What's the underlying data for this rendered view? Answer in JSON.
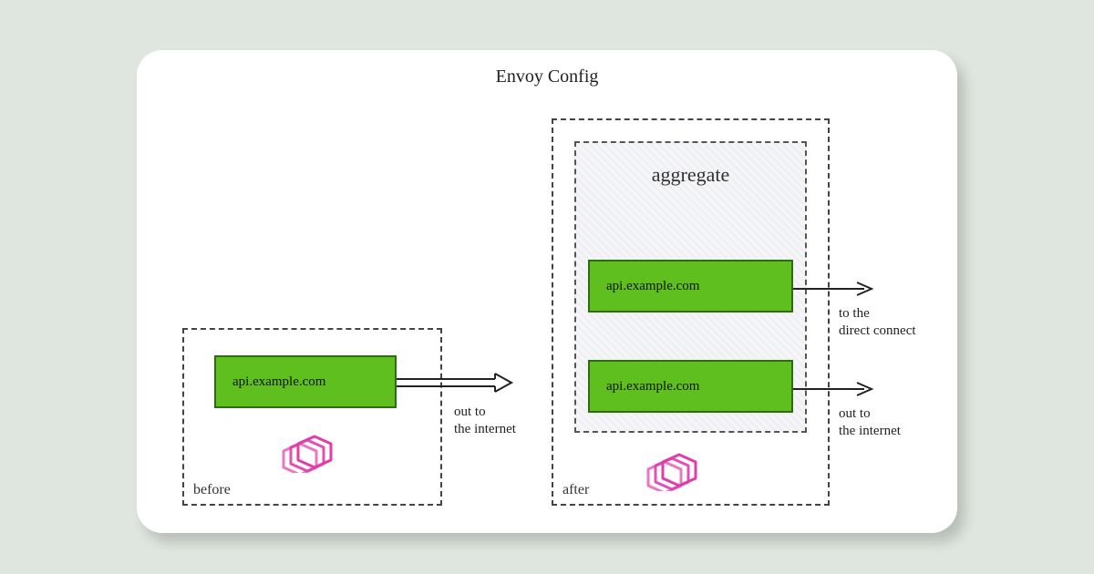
{
  "title": "Envoy Config",
  "before": {
    "label": "before",
    "cluster": "api.example.com",
    "arrow_note": "out to\nthe internet"
  },
  "after": {
    "label": "after",
    "aggregate_label": "aggregate",
    "cluster1": "api.example.com",
    "cluster2": "api.example.com",
    "arrow1_note": "to the\ndirect connect",
    "arrow2_note": "out to\nthe internet"
  },
  "colors": {
    "green": "#5fbf1f",
    "pink": "#e23cab"
  }
}
